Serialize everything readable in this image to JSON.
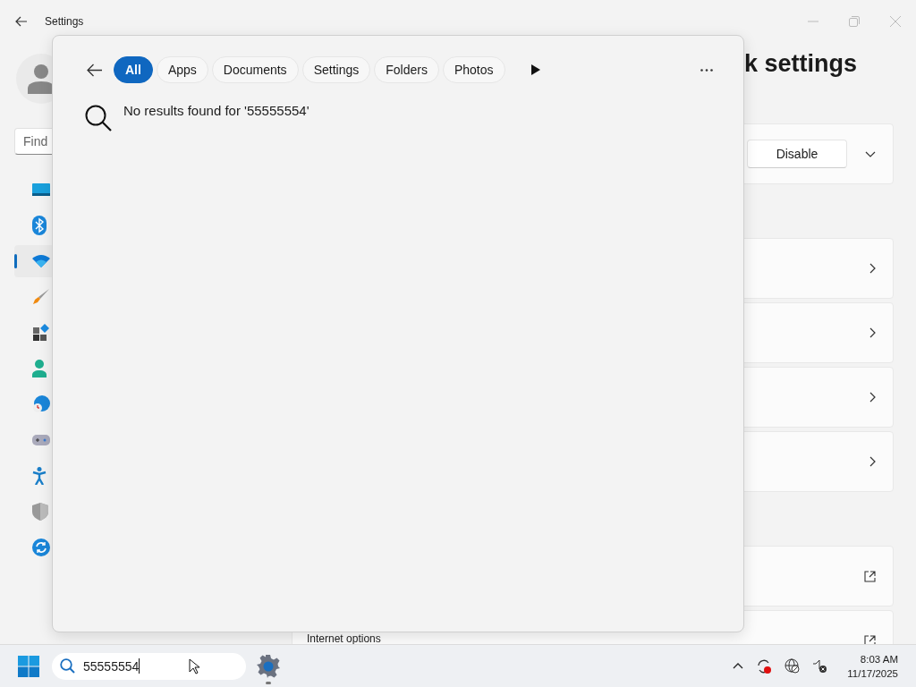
{
  "window": {
    "title": "Settings"
  },
  "sidebar": {
    "search": {
      "placeholder": "Find"
    },
    "items": [
      {
        "kind": "system",
        "selected": false
      },
      {
        "kind": "bluetooth",
        "selected": false
      },
      {
        "kind": "network",
        "selected": true
      },
      {
        "kind": "personalization",
        "selected": false
      },
      {
        "kind": "apps",
        "selected": false
      },
      {
        "kind": "accounts",
        "selected": false
      },
      {
        "kind": "time",
        "selected": false
      },
      {
        "kind": "gaming",
        "selected": false
      },
      {
        "kind": "accessibility",
        "selected": false
      },
      {
        "kind": "privacy",
        "selected": false
      },
      {
        "kind": "update",
        "selected": false
      }
    ]
  },
  "page": {
    "heading": "k settings",
    "groups": [
      [
        {
          "kind": "dropdown",
          "button": "Disable"
        }
      ],
      [
        {
          "kind": "link"
        },
        {
          "kind": "link"
        },
        {
          "kind": "link"
        },
        {
          "kind": "link"
        }
      ],
      [
        {
          "kind": "external"
        },
        {
          "kind": "external",
          "label": "Internet options"
        }
      ]
    ]
  },
  "search_panel": {
    "filters": [
      {
        "label": "All",
        "selected": true
      },
      {
        "label": "Apps",
        "selected": false
      },
      {
        "label": "Documents",
        "selected": false
      },
      {
        "label": "Settings",
        "selected": false
      },
      {
        "label": "Folders",
        "selected": false
      },
      {
        "label": "Photos",
        "selected": false
      }
    ],
    "message": "No results found for '55555554'"
  },
  "taskbar": {
    "search": {
      "value": "55555554"
    },
    "clock": {
      "time": "8:03 AM",
      "date": "11/17/2025"
    }
  }
}
